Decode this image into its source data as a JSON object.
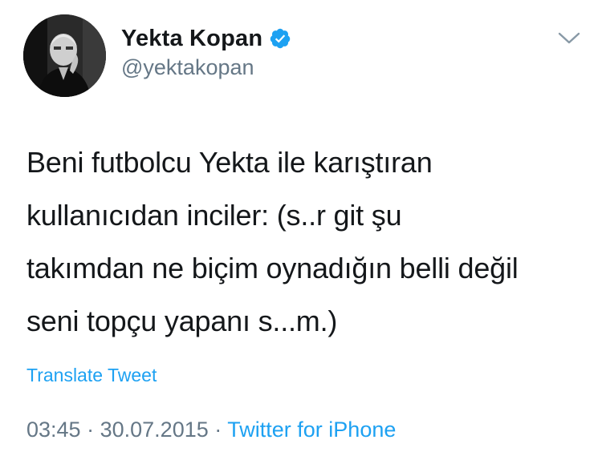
{
  "author": {
    "display_name": "Yekta Kopan",
    "handle": "@yektakopan",
    "verified": true
  },
  "tweet": {
    "text": "Beni futbolcu Yekta ile karıştıran\nkullanıcıdan inciler: (s..r git şu\ntakımdan ne biçim oynadığın belli değil\nseni topçu yapanı s...m.)",
    "translate_label": "Translate Tweet",
    "time": "03:45",
    "date": "30.07.2015",
    "separator": "·",
    "source": "Twitter for iPhone"
  },
  "icons": {
    "verified": "verified-badge-icon",
    "more": "chevron-down-icon"
  },
  "colors": {
    "accent": "#1da1f2",
    "muted": "#657786",
    "text": "#14171a"
  }
}
